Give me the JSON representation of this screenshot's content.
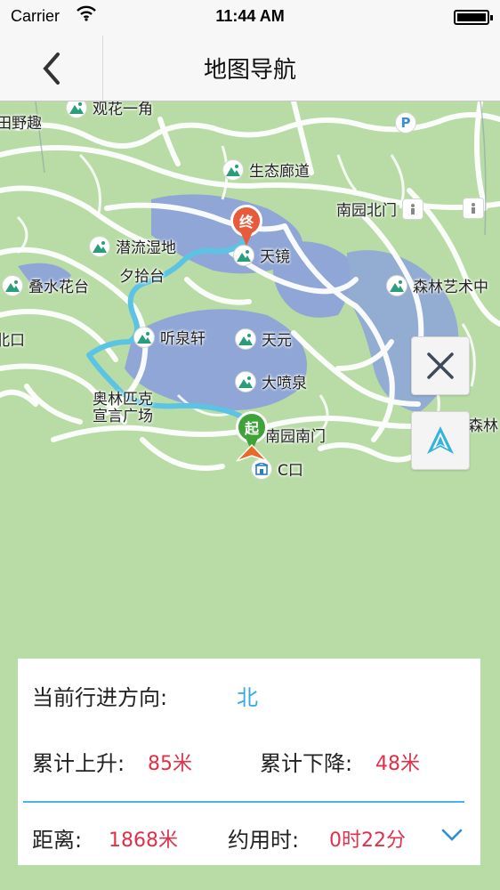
{
  "status": {
    "carrier": "Carrier",
    "time": "11:44 AM"
  },
  "nav": {
    "title": "地图导航"
  },
  "map": {
    "pois": [
      {
        "label": "生态廊道"
      },
      {
        "label": "潜流湿地"
      },
      {
        "label": "天镜"
      },
      {
        "label": "夕拾台"
      },
      {
        "label": "叠水花台"
      },
      {
        "label": "森林艺术中"
      },
      {
        "label": "听泉轩"
      },
      {
        "label": "天元"
      },
      {
        "label": "大喷泉"
      },
      {
        "label": "南园南门"
      },
      {
        "label": "C口"
      },
      {
        "label": "南园北门"
      },
      {
        "label": "观花一角"
      },
      {
        "label": "田野趣"
      },
      {
        "label": "北口"
      },
      {
        "label": "森林"
      }
    ],
    "plaza_lines": [
      "奥林匹克",
      "宣言广场"
    ],
    "end_marker": "终",
    "start_marker": "起",
    "parking_label": "P",
    "route_color": "#5bc4e4"
  },
  "info": {
    "direction_label": "当前行进方向:",
    "direction_value": "北",
    "ascent_label": "累计上升:",
    "ascent_value": "85米",
    "descent_label": "累计下降:",
    "descent_value": "48米",
    "distance_label": "距离:",
    "distance_value": "1868米",
    "time_label": "约用时:",
    "time_value": "0时22分"
  }
}
